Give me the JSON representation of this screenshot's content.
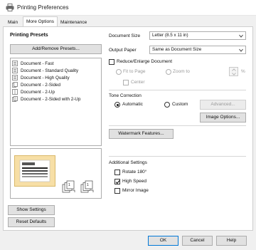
{
  "window": {
    "title": "Printing Preferences"
  },
  "tabs": [
    {
      "label": "Main"
    },
    {
      "label": "More Options"
    },
    {
      "label": "Maintenance"
    }
  ],
  "presets": {
    "title": "Printing Presets",
    "add_remove_label": "Add/Remove Presets...",
    "items": [
      {
        "label": "Document - Fast"
      },
      {
        "label": "Document - Standard Quality"
      },
      {
        "label": "Document - High Quality"
      },
      {
        "label": "Document - 2-Sided"
      },
      {
        "label": "Document - 2-Up"
      },
      {
        "label": "Document - 2-Sided with 2-Up"
      }
    ]
  },
  "left_buttons": {
    "show_settings": "Show Settings",
    "reset_defaults": "Reset Defaults"
  },
  "document_size": {
    "label": "Document Size",
    "value": "Letter (8.5 x 11 in)"
  },
  "output_paper": {
    "label": "Output Paper",
    "value": "Same as Document Size"
  },
  "reduce_enlarge": {
    "label": "Reduce/Enlarge Document",
    "fit_to_page": "Fit to Page",
    "zoom_to": "Zoom to",
    "percent": "%",
    "center": "Center"
  },
  "tone_correction": {
    "title": "Tone Correction",
    "automatic": "Automatic",
    "custom": "Custom",
    "advanced": "Advanced...",
    "image_options": "Image Options..."
  },
  "watermark_label": "Watermark Features...",
  "additional": {
    "title": "Additional Settings",
    "rotate": "Rotate 180°",
    "high_speed": "High Speed",
    "mirror": "Mirror Image"
  },
  "footer": {
    "ok": "OK",
    "cancel": "Cancel",
    "help": "Help"
  }
}
